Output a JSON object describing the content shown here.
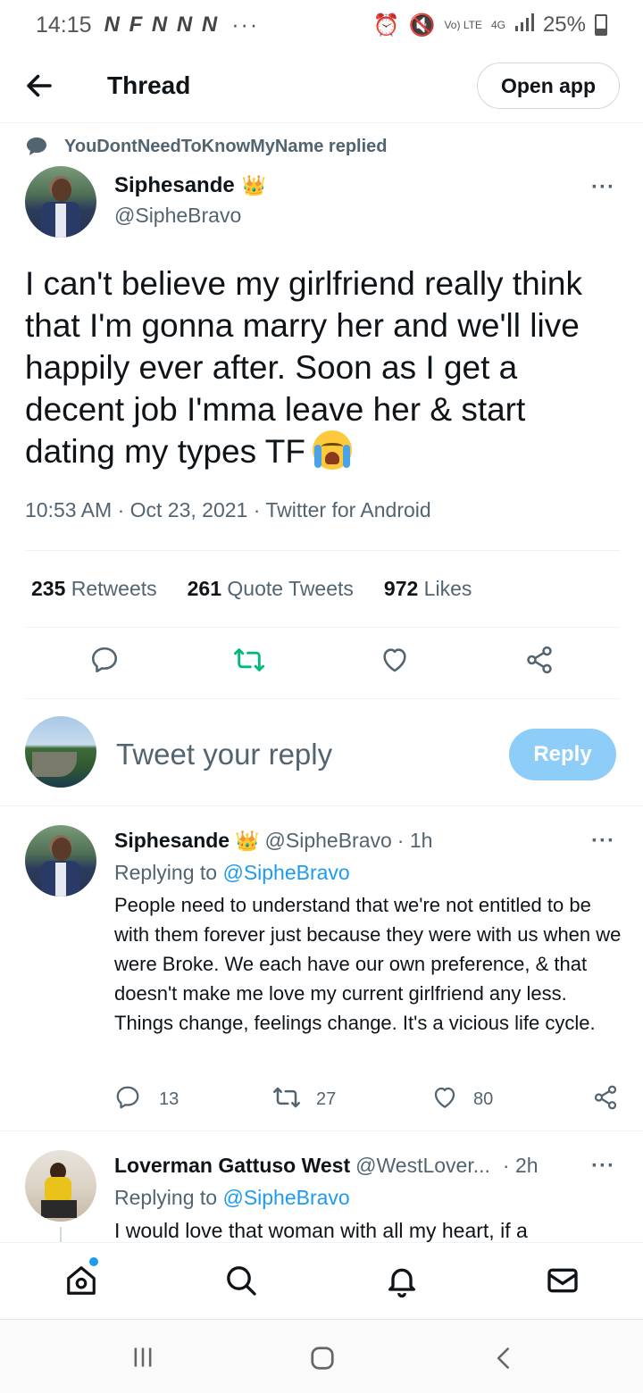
{
  "status_bar": {
    "time": "14:15",
    "notifications": "N F N N N",
    "more": "···",
    "volte": "Vo) LTE",
    "network": "4G",
    "battery": "25%"
  },
  "header": {
    "title": "Thread",
    "open_app": "Open app"
  },
  "context": {
    "replied": "YouDontNeedToKnowMyName replied"
  },
  "tweet": {
    "name": "Siphesande",
    "handle": "@SipheBravo",
    "text": "I can't believe my girlfriend really think that I'm gonna marry her and we'll live happily ever after. Soon as I get a decent job I'mma leave her & start dating my types TF",
    "emoji": "loudly-crying-face",
    "meta": "10:53 AM · Oct 23, 2021 · Twitter for Android",
    "retweets": "235",
    "retweets_label": "Retweets",
    "quotes": "261",
    "quotes_label": "Quote Tweets",
    "likes": "972",
    "likes_label": "Likes"
  },
  "compose": {
    "placeholder": "Tweet your reply",
    "reply_button": "Reply"
  },
  "replies": [
    {
      "name": "Siphesande",
      "handle": "@SipheBravo",
      "time": "· 1h",
      "replying_prefix": "Replying to",
      "replying_to": "@SipheBravo",
      "text": "People need to understand that we're not entitled to be with them forever just because they were with us when we were Broke. We each have our own preference, & that doesn't make me love my current girlfriend any less. Things change, feelings change. It's a vicious life cycle.",
      "reply_count": "13",
      "retweet_count": "27",
      "like_count": "80"
    },
    {
      "name": "Loverman Gattuso West",
      "handle": "@WestLover...",
      "time": "· 2h",
      "replying_prefix": "Replying to",
      "replying_to": "@SipheBravo",
      "text": "I would love that woman with all my heart, if a"
    }
  ],
  "colors": {
    "accent": "#1d9bf0",
    "retweet_green": "#00ba7c",
    "secondary_text": "#536471",
    "reply_button_bg": "#8ecdf8"
  },
  "icons": {
    "back": "arrow-left-icon",
    "more": "more-dots-icon",
    "reply": "reply-bubble-icon",
    "retweet": "retweet-icon",
    "like": "heart-icon",
    "share": "share-icon",
    "nav": [
      "home-icon",
      "search-icon",
      "bell-icon",
      "mail-icon"
    ],
    "system": [
      "recent-apps-icon",
      "home-circle-icon",
      "back-chevron-icon"
    ]
  }
}
